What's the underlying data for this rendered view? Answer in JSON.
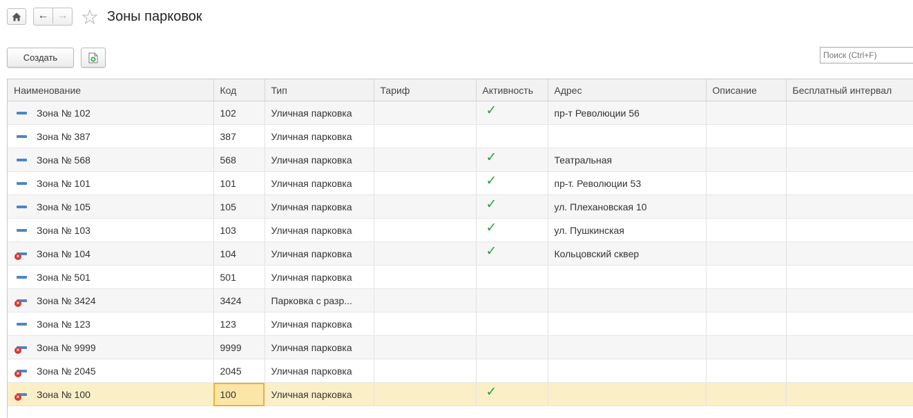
{
  "header": {
    "title": "Зоны парковок"
  },
  "toolbar": {
    "create_label": "Создать",
    "search_placeholder": "Поиск (Ctrl+F)"
  },
  "table": {
    "columns": [
      "Наименование",
      "Код",
      "Тип",
      "Тариф",
      "Активность",
      "Адрес",
      "Описание",
      "Бесплатный интервал"
    ],
    "rows": [
      {
        "name": "Зона № 102",
        "code": "102",
        "type": "Уличная парковка",
        "tariff": "",
        "active": true,
        "address": "пр-т Революции 56",
        "description": "",
        "free_interval": "",
        "marked_for_deletion": false
      },
      {
        "name": "Зона № 387",
        "code": "387",
        "type": "Уличная парковка",
        "tariff": "",
        "active": false,
        "address": "",
        "description": "",
        "free_interval": "",
        "marked_for_deletion": false
      },
      {
        "name": "Зона № 568",
        "code": "568",
        "type": "Уличная парковка",
        "tariff": "",
        "active": true,
        "address": "Театральная",
        "description": "",
        "free_interval": "",
        "marked_for_deletion": false
      },
      {
        "name": "Зона № 101",
        "code": "101",
        "type": "Уличная парковка",
        "tariff": "",
        "active": true,
        "address": "пр-т. Революции 53",
        "description": "",
        "free_interval": "",
        "marked_for_deletion": false
      },
      {
        "name": "Зона № 105",
        "code": "105",
        "type": "Уличная парковка",
        "tariff": "",
        "active": true,
        "address": "ул. Плехановская 10",
        "description": "",
        "free_interval": "",
        "marked_for_deletion": false
      },
      {
        "name": "Зона № 103",
        "code": "103",
        "type": "Уличная парковка",
        "tariff": "",
        "active": true,
        "address": "ул. Пушкинская",
        "description": "",
        "free_interval": "",
        "marked_for_deletion": false
      },
      {
        "name": "Зона № 104",
        "code": "104",
        "type": "Уличная парковка",
        "tariff": "",
        "active": true,
        "address": "Кольцовский сквер",
        "description": "",
        "free_interval": "",
        "marked_for_deletion": true
      },
      {
        "name": "Зона № 501",
        "code": "501",
        "type": "Уличная парковка",
        "tariff": "",
        "active": false,
        "address": "",
        "description": "",
        "free_interval": "",
        "marked_for_deletion": false
      },
      {
        "name": "Зона № 3424",
        "code": "3424",
        "type": "Парковка с разр...",
        "tariff": "",
        "active": false,
        "address": "",
        "description": "",
        "free_interval": "",
        "marked_for_deletion": true
      },
      {
        "name": "Зона № 123",
        "code": "123",
        "type": "Уличная парковка",
        "tariff": "",
        "active": false,
        "address": "",
        "description": "",
        "free_interval": "",
        "marked_for_deletion": false
      },
      {
        "name": "Зона № 9999",
        "code": "9999",
        "type": "Уличная парковка",
        "tariff": "",
        "active": false,
        "address": "",
        "description": "",
        "free_interval": "",
        "marked_for_deletion": true
      },
      {
        "name": "Зона № 2045",
        "code": "2045",
        "type": "Уличная парковка",
        "tariff": "",
        "active": false,
        "address": "",
        "description": "",
        "free_interval": "",
        "marked_for_deletion": true
      },
      {
        "name": "Зона № 100",
        "code": "100",
        "type": "Уличная парковка",
        "tariff": "",
        "active": true,
        "address": "",
        "description": "",
        "free_interval": "",
        "marked_for_deletion": true,
        "selected": true
      }
    ]
  },
  "icons": {
    "home": "home-icon",
    "back": "arrow-left-icon",
    "forward": "arrow-right-icon",
    "favorite": "star-outline-icon",
    "copy": "add-document-icon",
    "row_item": "catalog-item-icon",
    "row_deleted": "item-marked-for-deletion-icon",
    "active": "checkmark-icon"
  },
  "colors": {
    "selected_row": "#fbefc7",
    "selected_cell_border": "#f0b232",
    "check": "#2a9d3e",
    "item_icon": "#4b86c7",
    "delete_mark": "#d9352b"
  }
}
